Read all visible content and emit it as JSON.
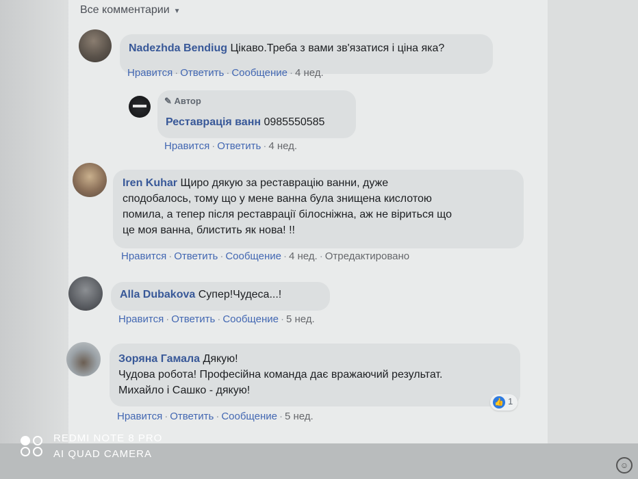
{
  "sort": {
    "label": "Все комментарии",
    "caret": "▼"
  },
  "comments": [
    {
      "author": "Nadezhda Bendiug",
      "text": "Цікаво.Треба з вами зв'язатися і ціна яка?",
      "actions": {
        "like": "Нравится",
        "reply": "Ответить",
        "message": "Сообщение",
        "time": "4 нед."
      }
    },
    {
      "badge": "Автор",
      "author": "Реставрація ванн",
      "text": "0985550585",
      "actions": {
        "like": "Нравится",
        "reply": "Ответить",
        "time": "4 нед."
      }
    },
    {
      "author": "Iren Kuhar",
      "lines": [
        "Щиро дякую за реставрацію ванни, дуже",
        "сподобалось, тому що у мене ванна була знищена кислотою",
        "помила, а тепер після реставрації білосніжна, аж не віриться що",
        "це моя ванна, блистить як нова! !!"
      ],
      "actions": {
        "like": "Нравится",
        "reply": "Ответить",
        "message": "Сообщение",
        "time": "4 нед.",
        "edited": "Отредактировано"
      }
    },
    {
      "author": "Alla Dubakova",
      "text": "Супер!Чудеса...!",
      "actions": {
        "like": "Нравится",
        "reply": "Ответить",
        "message": "Сообщение",
        "time": "5 нед."
      }
    },
    {
      "author": "Зоряна Гамала",
      "lines": [
        "Дякую!",
        "Чудова робота! Професійна команда дає вражаючий результат.",
        "Михайло і Сашко - дякую!"
      ],
      "reactions": "1",
      "actions": {
        "like": "Нравится",
        "reply": "Ответить",
        "message": "Сообщение",
        "time": "5 нед."
      }
    }
  ],
  "watermark": {
    "line1": "REDMI NOTE 8 PRO",
    "line2": "AI QUAD CAMERA"
  }
}
